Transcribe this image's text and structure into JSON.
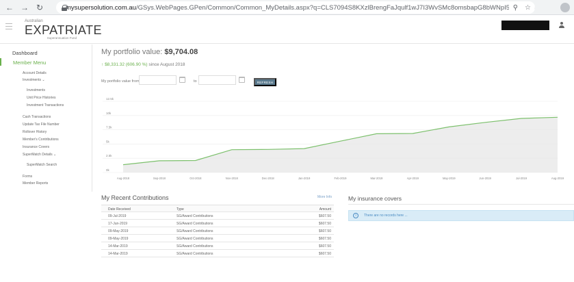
{
  "browser": {
    "url_host": "mysupersolution.com.au",
    "url_path": "/GSys.WebPages.GPen/Common/Common_MyDetails.aspx?q=CLS7094S8KXzlBrengFaJqulf1wJ7I3WvSMc8omsbapG8bWNpI55ICsFbgejqdcJSZWtF6l..."
  },
  "logo": {
    "top": "Australian",
    "main": "EXPATRIATE",
    "sub": "Superannuation Fund"
  },
  "sidebar": {
    "dashboard": "Dashboard",
    "member_menu": "Member Menu",
    "items": [
      {
        "label": "Account Details"
      },
      {
        "label": "Investments"
      },
      {
        "label": "Investments"
      },
      {
        "label": "Unit Price Histories"
      },
      {
        "label": "Investment Transactions"
      },
      {
        "label": "Cash Transactions"
      },
      {
        "label": "Update Tax File Number"
      },
      {
        "label": "Rollover History"
      },
      {
        "label": "Member's Contributions"
      },
      {
        "label": "Insurance Covers"
      },
      {
        "label": "SuperMatch Details"
      },
      {
        "label": "SuperMatch Search"
      },
      {
        "label": "Forms"
      },
      {
        "label": "Member Reports"
      }
    ]
  },
  "portfolio": {
    "title_prefix": "My portfolio value:",
    "value": "$9,704.08",
    "change": "$8,331.32 (606.90 %)",
    "since": "since August 2018"
  },
  "filter": {
    "from_label": "My portfolio value from",
    "to_label": "to",
    "refresh_label": "REFRESH"
  },
  "chart_data": {
    "type": "area",
    "categories": [
      "Aug-2018",
      "Sep-2018",
      "Oct-2018",
      "Nov-2018",
      "Dec-2018",
      "Jan-2019",
      "Feb-2019",
      "Mar-2019",
      "Apr-2019",
      "May-2019",
      "Jun-2019",
      "Jul-2019",
      "Aug-2019"
    ],
    "values": [
      1372.76,
      2050,
      2100,
      4000,
      4050,
      4200,
      5500,
      6800,
      6850,
      8000,
      8800,
      9500,
      9704.08
    ],
    "ytick_labels": [
      "0k",
      "2.5k",
      "5k",
      "7.5k",
      "10k",
      "12.5k"
    ],
    "ylim": [
      0,
      12500
    ],
    "colors": {
      "line": "#7cc06c",
      "fill": "#e8e8e8"
    }
  },
  "contributions": {
    "title": "My Recent Contributions",
    "more_info": "More Info",
    "headers": {
      "date": "Date Received",
      "type": "Type",
      "amount": "Amount"
    },
    "rows": [
      {
        "date": "09-Jul-2019",
        "type": "SG/Award Contributions",
        "amount": "$607.50"
      },
      {
        "date": "17-Jun-2019",
        "type": "SG/Award Contributions",
        "amount": "$607.50"
      },
      {
        "date": "09-May-2019",
        "type": "SG/Award Contributions",
        "amount": "$607.50"
      },
      {
        "date": "09-May-2019",
        "type": "SG/Award Contributions",
        "amount": "$607.50"
      },
      {
        "date": "14-Mar-2019",
        "type": "SG/Award Contributions",
        "amount": "$607.50"
      },
      {
        "date": "14-Mar-2019",
        "type": "SG/Award Contributions",
        "amount": "$607.50"
      }
    ]
  },
  "insurance": {
    "title": "My insurance covers",
    "message": "There are no records here ..."
  }
}
